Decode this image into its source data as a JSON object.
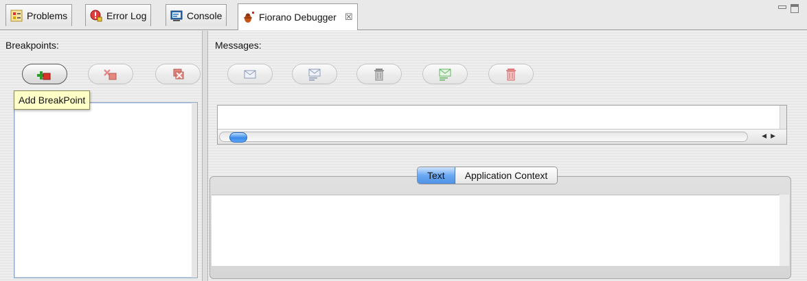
{
  "tabs": [
    {
      "label": "Problems",
      "icon": "problems-icon",
      "active": false
    },
    {
      "label": "Error Log",
      "icon": "error-log-icon",
      "active": false
    },
    {
      "label": "Console",
      "icon": "console-icon",
      "active": false
    },
    {
      "label": "Fiorano Debugger",
      "icon": "debugger-icon",
      "active": true,
      "close": "☒"
    }
  ],
  "breakpoints": {
    "label": "Breakpoints:",
    "buttons": [
      {
        "name": "add-breakpoint-button",
        "icon": "add-breakpoint-icon",
        "enabled": true
      },
      {
        "name": "remove-breakpoint-button",
        "icon": "remove-breakpoint-icon",
        "enabled": false
      },
      {
        "name": "remove-all-breakpoints-button",
        "icon": "remove-all-breakpoints-icon",
        "enabled": false
      }
    ],
    "tooltip": "Add BreakPoint"
  },
  "messages": {
    "label": "Messages:",
    "buttons": [
      {
        "name": "view-message-button",
        "icon": "envelope-icon",
        "enabled": false
      },
      {
        "name": "edit-message-button",
        "icon": "edit-envelope-icon",
        "enabled": false
      },
      {
        "name": "delete-message-button",
        "icon": "trash-icon",
        "enabled": false
      },
      {
        "name": "send-message-button",
        "icon": "send-envelope-icon",
        "enabled": false
      },
      {
        "name": "delete-all-messages-button",
        "icon": "trash-red-icon",
        "enabled": false
      }
    ]
  },
  "content_tabs": {
    "text": "Text",
    "app_context": "Application Context",
    "selected": "Text"
  },
  "colors": {
    "accent": "#4e92e6",
    "tooltip_bg": "#ffffc8"
  }
}
